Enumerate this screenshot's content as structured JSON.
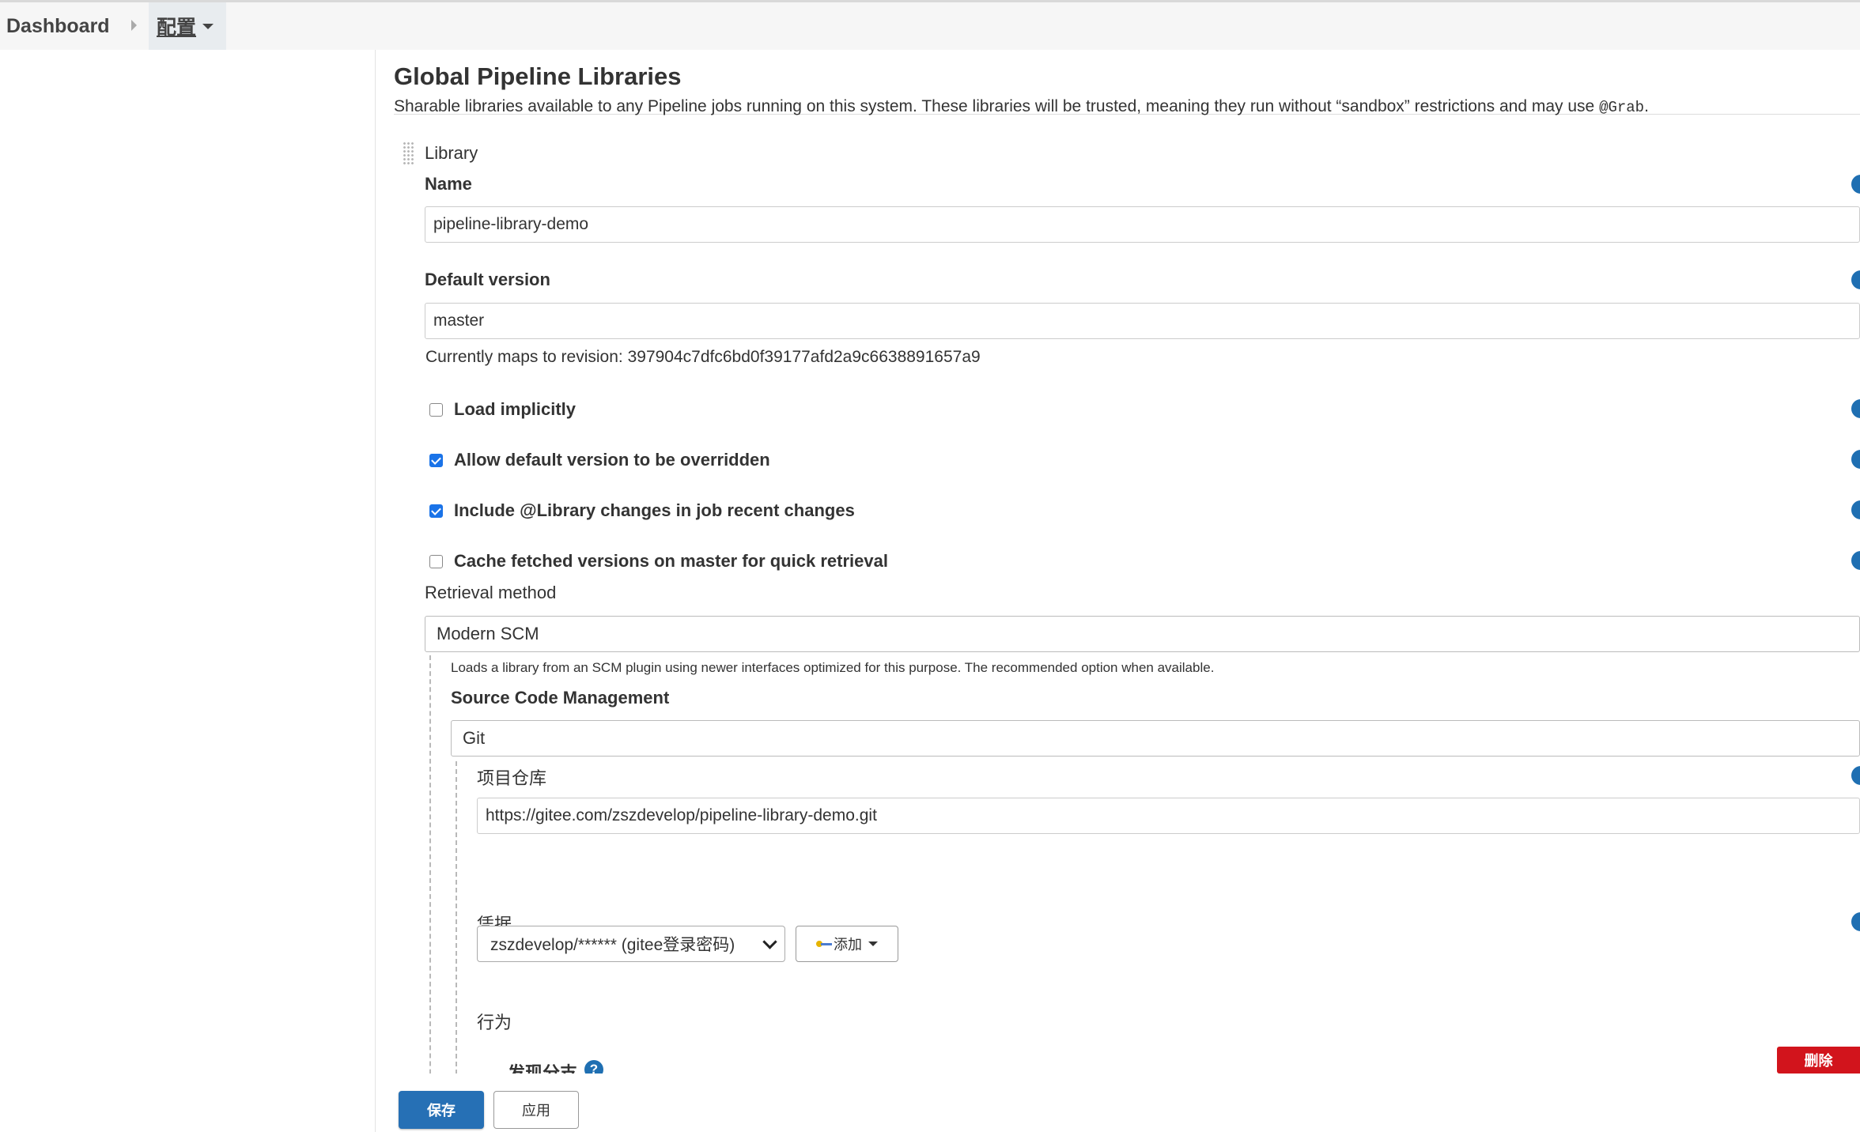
{
  "breadcrumb": {
    "dashboard": "Dashboard",
    "current": "配置"
  },
  "section": {
    "title": "Global Pipeline Libraries",
    "description": "Sharable libraries available to any Pipeline jobs running on this system. These libraries will be trusted, meaning they run without “sandbox” restrictions and may use ",
    "description_code": "@Grab",
    "description_end": "."
  },
  "library": {
    "header": "Library",
    "name_label": "Name",
    "name_value": "pipeline-library-demo",
    "default_version_label": "Default version",
    "default_version_value": "master",
    "revision_text": "Currently maps to revision: 397904c7dfc6bd0f39177afd2a9c6638891657a9",
    "checkboxes": [
      {
        "label": "Load implicitly",
        "checked": false
      },
      {
        "label": "Allow default version to be overridden",
        "checked": true
      },
      {
        "label": "Include @Library changes in job recent changes",
        "checked": true
      },
      {
        "label": "Cache fetched versions on master for quick retrieval",
        "checked": false
      }
    ],
    "retrieval_label": "Retrieval method",
    "retrieval_value": "Modern SCM",
    "retrieval_hint": "Loads a library from an SCM plugin using newer interfaces optimized for this purpose. The recommended option when available.",
    "scm_label": "Source Code Management",
    "scm_value": "Git",
    "repo_label": "项目仓库",
    "repo_value": "https://gitee.com/zszdevelop/pipeline-library-demo.git",
    "credentials_label": "凭据",
    "credentials_value": "zszdevelop/****** (gitee登录密码)",
    "add_label": "添加",
    "behaviors_label": "行为",
    "discover_branches_label": "发现分支",
    "help_glyph": "?",
    "delete_label": "删除"
  },
  "actions": {
    "save": "保存",
    "apply": "应用"
  },
  "colors": {
    "primary": "#2670b5",
    "help": "#1f6fb2",
    "danger": "#d2141c",
    "checkbox": "#1a73e8"
  }
}
